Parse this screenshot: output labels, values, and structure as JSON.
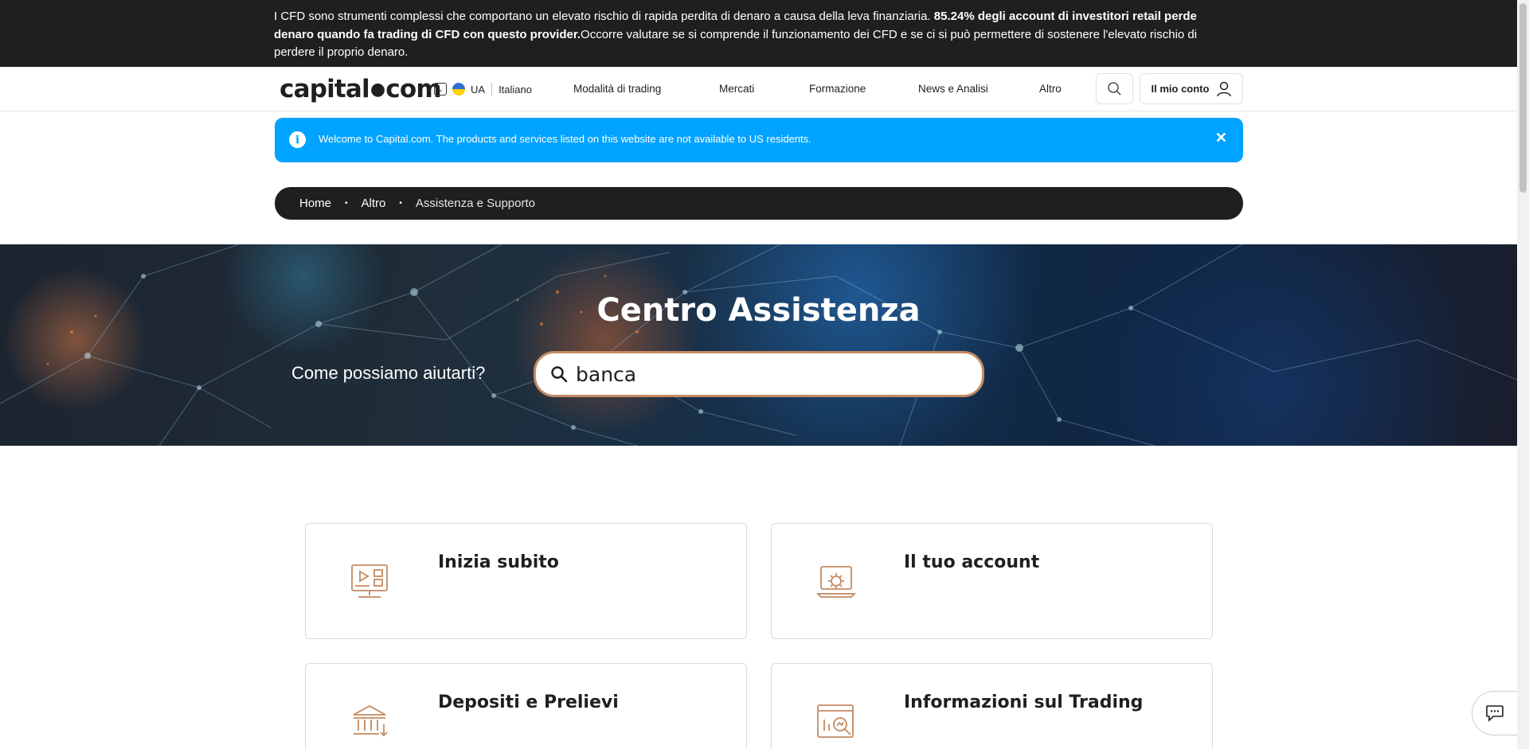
{
  "risk_banner": {
    "text_1": "I CFD sono strumenti complessi che comportano un elevato rischio di rapida perdita di denaro a causa della leva finanziaria. ",
    "text_bold": "85.24% degli account di investitori retail perde denaro quando fa trading di CFD con questo provider.",
    "text_2": "Occorre valutare se si comprende il funzionamento dei CFD e se ci si può permettere di sostenere l'elevato rischio di perdere il proprio denaro."
  },
  "header": {
    "logo_left": "capital",
    "logo_dot": "●",
    "logo_right": "com",
    "region": "UA",
    "language": "Italiano",
    "nav": [
      "Modalità di trading",
      "Mercati",
      "Formazione",
      "News e Analisi",
      "Altro"
    ],
    "account_label": "Il mio conto",
    "search_icon": "search-icon",
    "account_icon": "user-icon"
  },
  "info_banner": {
    "icon": "i",
    "text": "Welcome to Capital.com. The products and services listed on this website are not available to US residents.",
    "close": "✕"
  },
  "breadcrumb": {
    "items": [
      "Home",
      "Altro",
      "Assistenza e Supporto"
    ],
    "separator": "•"
  },
  "hero": {
    "title": "Centro Assistenza",
    "question": "Come possiamo aiutarti?",
    "search_value": "banca"
  },
  "cards": [
    {
      "title": "Inizia subito",
      "icon": "video-screen-icon"
    },
    {
      "title": "Il tuo account",
      "icon": "laptop-gear-icon"
    },
    {
      "title": "Depositi e Prelievi",
      "icon": "bank-icon"
    },
    {
      "title": "Informazioni sul Trading",
      "icon": "chart-magnifier-icon"
    }
  ],
  "colors": {
    "accent": "#c58a62",
    "info": "#00a3ff",
    "dark": "#1f1f1f"
  }
}
